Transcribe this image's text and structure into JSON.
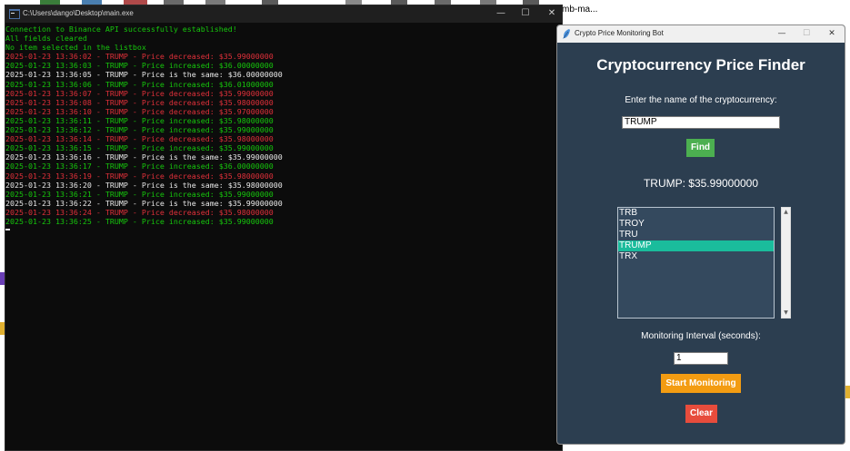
{
  "desktop": {
    "partial_label": "mb-ma..."
  },
  "console": {
    "title": "C:\\Users\\dango\\Desktop\\main.exe",
    "controls": {
      "minimize": "—",
      "maximize": "☐",
      "close": "✕"
    },
    "lines": [
      {
        "text": "Connection to Binance API successfully established!",
        "color": "green"
      },
      {
        "text": "All fields cleared",
        "color": "green"
      },
      {
        "text": "No item selected in the listbox",
        "color": "green"
      },
      {
        "text": "2025-01-23 13:36:02 - TRUMP - Price decreased: $35.99000000",
        "color": "red"
      },
      {
        "text": "2025-01-23 13:36:03 - TRUMP - Price increased: $36.00000000",
        "color": "green"
      },
      {
        "text": "2025-01-23 13:36:05 - TRUMP - Price is the same: $36.00000000",
        "color": "white"
      },
      {
        "text": "2025-01-23 13:36:06 - TRUMP - Price increased: $36.01000000",
        "color": "green"
      },
      {
        "text": "2025-01-23 13:36:07 - TRUMP - Price decreased: $35.99000000",
        "color": "red"
      },
      {
        "text": "2025-01-23 13:36:08 - TRUMP - Price decreased: $35.98000000",
        "color": "red"
      },
      {
        "text": "2025-01-23 13:36:10 - TRUMP - Price decreased: $35.97000000",
        "color": "red"
      },
      {
        "text": "2025-01-23 13:36:11 - TRUMP - Price increased: $35.98000000",
        "color": "green"
      },
      {
        "text": "2025-01-23 13:36:12 - TRUMP - Price increased: $35.99000000",
        "color": "green"
      },
      {
        "text": "2025-01-23 13:36:14 - TRUMP - Price decreased: $35.98000000",
        "color": "red"
      },
      {
        "text": "2025-01-23 13:36:15 - TRUMP - Price increased: $35.99000000",
        "color": "green"
      },
      {
        "text": "2025-01-23 13:36:16 - TRUMP - Price is the same: $35.99000000",
        "color": "white"
      },
      {
        "text": "2025-01-23 13:36:17 - TRUMP - Price increased: $36.00000000",
        "color": "green"
      },
      {
        "text": "2025-01-23 13:36:19 - TRUMP - Price decreased: $35.98000000",
        "color": "red"
      },
      {
        "text": "2025-01-23 13:36:20 - TRUMP - Price is the same: $35.98000000",
        "color": "white"
      },
      {
        "text": "2025-01-23 13:36:21 - TRUMP - Price increased: $35.99000000",
        "color": "green"
      },
      {
        "text": "2025-01-23 13:36:22 - TRUMP - Price is the same: $35.99000000",
        "color": "white"
      },
      {
        "text": "2025-01-23 13:36:24 - TRUMP - Price decreased: $35.98000000",
        "color": "red"
      },
      {
        "text": "2025-01-23 13:36:25 - TRUMP - Price increased: $35.99000000",
        "color": "green"
      }
    ]
  },
  "bot": {
    "title": "Crypto Price Monitoring Bot",
    "controls": {
      "minimize": "—",
      "maximize": "☐",
      "close": "✕"
    },
    "heading": "Cryptocurrency Price Finder",
    "prompt": "Enter the name of the cryptocurrency:",
    "crypto_input_value": "TRUMP",
    "find_label": "Find",
    "price_text": "TRUMP: $35.99000000",
    "list_items": [
      "TRB",
      "TROY",
      "TRU",
      "TRUMP",
      "TRX"
    ],
    "selected_item": "TRUMP",
    "interval_label": "Monitoring Interval (seconds):",
    "interval_value": "1",
    "start_label": "Start Monitoring",
    "clear_label": "Clear",
    "colors": {
      "background": "#2c3e50",
      "find": "#4caf50",
      "start": "#f39c12",
      "clear": "#e74c3c",
      "selection": "#1abc9c"
    }
  }
}
